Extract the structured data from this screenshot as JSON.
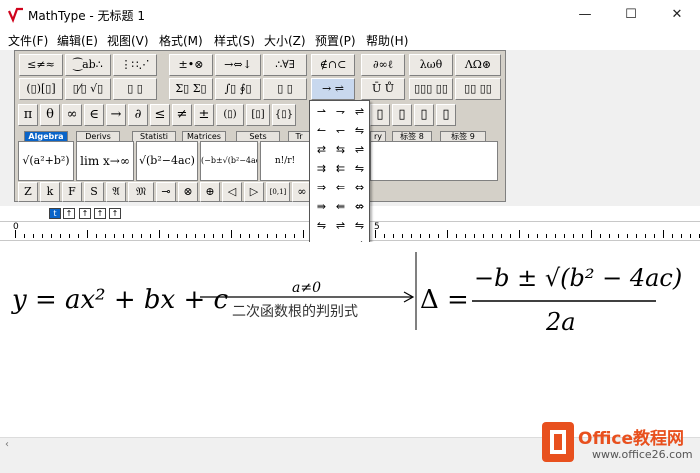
{
  "window": {
    "title": "MathType - 无标题 1",
    "controls": {
      "minimize": "—",
      "maximize": "☐",
      "close": "✕"
    }
  },
  "menu": [
    "文件(F)",
    "编辑(E)",
    "视图(V)",
    "格式(M)",
    "样式(S)",
    "大小(Z)",
    "预置(P)",
    "帮助(H)"
  ],
  "palette_row1": [
    "≤≠≈",
    "⁐ab∴",
    "⋮∷⋰",
    "±•⊗",
    "→⇔↓",
    "∴∀∃",
    "∉∩⊂",
    "∂∞ℓ",
    "λωθ",
    "ΛΩ⊛"
  ],
  "palette_row2": [
    "(▯)[▯]",
    "▯⁄▯ √▯",
    "▯ ▯",
    "Σ▯ Σ▯",
    "∫▯ ∮▯",
    "▯ ▯",
    "→ ⇌",
    "Ū Ů",
    "▯▯▯ ▯▯",
    "▯▯ ▯▯"
  ],
  "symbols": [
    "π",
    "θ",
    "∞",
    "∈",
    "→",
    "∂",
    "≤",
    "≠",
    "±",
    "(▯)",
    "[▯]",
    "{▯}",
    "▯",
    "▯",
    "▯",
    "▯"
  ],
  "tabs": [
    "Algebra",
    "Derivs",
    "Statisti",
    "Matrices",
    "Sets",
    "Tr",
    "ry",
    "标签 8",
    "标签 9"
  ],
  "templates": [
    "√(a²+b²)",
    "lim x→∞",
    "√(b²−4ac)",
    "(−b±√(b²−4ac))/2a",
    "n!/r!(n−r)!"
  ],
  "small_buttons": [
    "Z",
    "k",
    "F",
    "S",
    "𝔄",
    "𝔐",
    "⊸",
    "⊗",
    "⊕",
    "◁",
    "▷",
    "[0,1]",
    "∞"
  ],
  "style_buttons": [
    "t",
    "↑",
    "↑",
    "↑",
    "↑"
  ],
  "ruler_labels": [
    "0",
    "5"
  ],
  "equation": {
    "left": "y = ax² + bx + c",
    "over_arrow": "a≠0",
    "under_arrow": "二次函数根的判别式",
    "delta": "Δ =",
    "numerator": "−b ± √(b² − 4ac)",
    "denominator": "2a"
  },
  "watermark": {
    "brand": "Office教程网",
    "url": "www.office26.com",
    "brand_color": "#e8501e"
  }
}
